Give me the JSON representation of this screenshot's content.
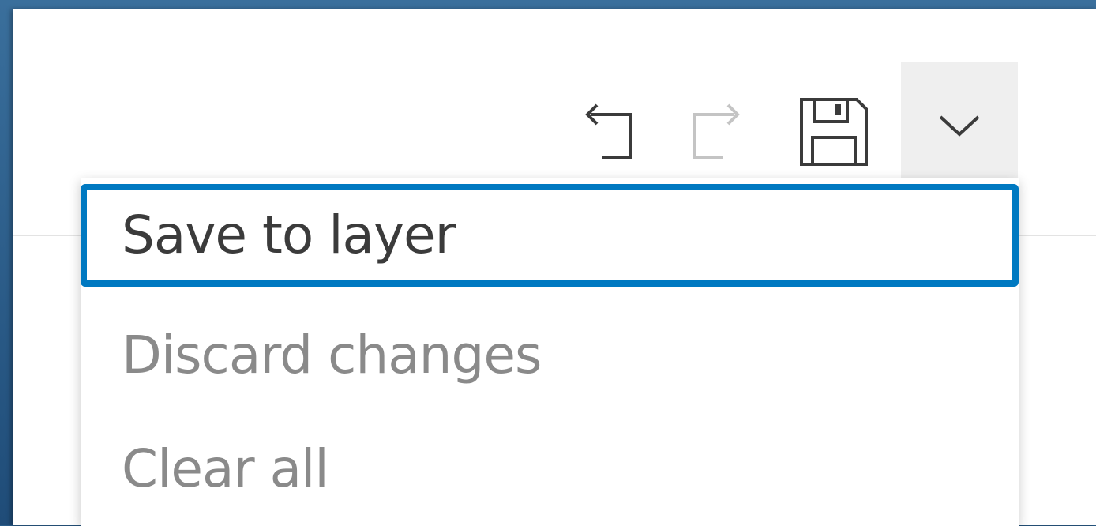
{
  "toolbar": {
    "undo_icon": "undo-icon",
    "redo_icon": "redo-icon",
    "save_icon": "save-icon",
    "menu_icon": "chevron-down-icon"
  },
  "menu": {
    "items": [
      {
        "label": "Save to layer",
        "state": "focused"
      },
      {
        "label": "Discard changes",
        "state": "disabled"
      },
      {
        "label": "Clear all",
        "state": "disabled"
      }
    ]
  },
  "colors": {
    "focus_ring": "#0079c1",
    "text_primary": "#3b3b3b",
    "text_disabled": "#8a8a8a",
    "icon_active": "#3b3b3b",
    "icon_disabled": "#c4c4c4",
    "menu_button_bg": "#efefef"
  }
}
